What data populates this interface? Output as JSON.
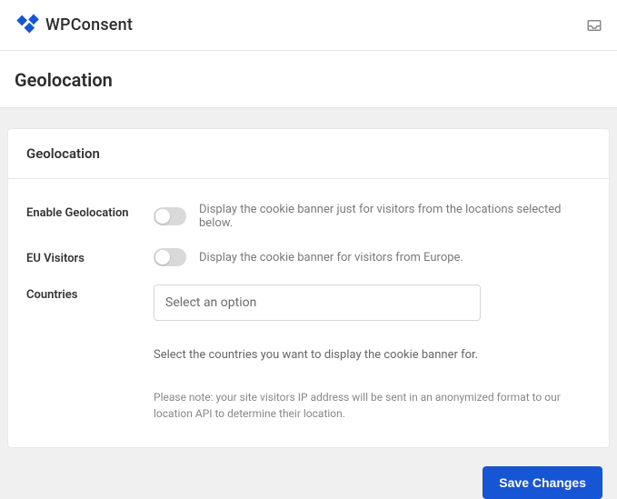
{
  "brand": {
    "name": "WPConsent"
  },
  "page": {
    "title": "Geolocation"
  },
  "card": {
    "header": "Geolocation",
    "rows": {
      "enable": {
        "label": "Enable Geolocation",
        "desc": "Display the cookie banner just for visitors from the locations selected below."
      },
      "eu": {
        "label": "EU Visitors",
        "desc": "Display the cookie banner for visitors from Europe."
      },
      "countries": {
        "label": "Countries",
        "placeholder": "Select an option",
        "help": "Select the countries you want to display the cookie banner for.",
        "note": "Please note: your site visitors IP address will be sent in an anonymized format to our location API to determine their location."
      }
    }
  },
  "actions": {
    "save": "Save Changes"
  }
}
